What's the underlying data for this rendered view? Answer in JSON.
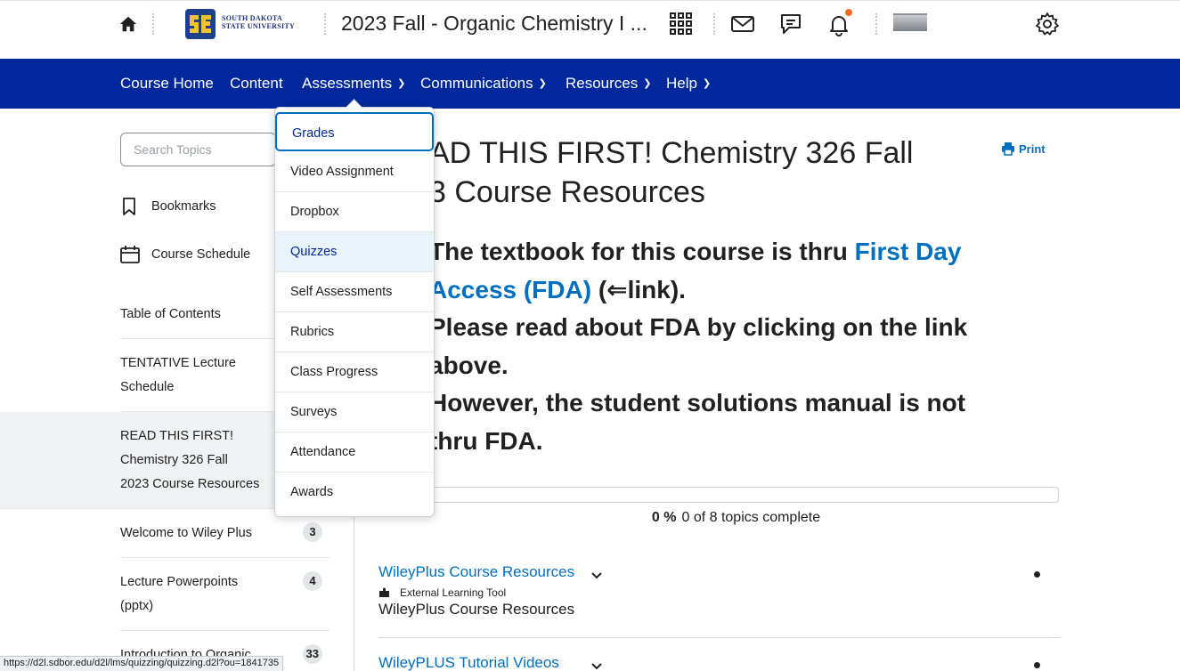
{
  "header": {
    "logo_line1": "South Dakota",
    "logo_line2": "State University",
    "course_title": "2023 Fall - Organic Chemistry I ..."
  },
  "nav": {
    "items": [
      {
        "label": "Course Home"
      },
      {
        "label": "Content"
      },
      {
        "label": "Assessments",
        "has_menu": true
      },
      {
        "label": "Communications",
        "has_menu": true
      },
      {
        "label": "Resources",
        "has_menu": true
      },
      {
        "label": "Help",
        "has_menu": true
      }
    ]
  },
  "dropdown": {
    "items": [
      {
        "label": "Grades",
        "state": "focused"
      },
      {
        "label": "Video Assignment"
      },
      {
        "label": "Dropbox"
      },
      {
        "label": "Quizzes",
        "state": "hover"
      },
      {
        "label": "Self Assessments"
      },
      {
        "label": "Rubrics"
      },
      {
        "label": "Class Progress"
      },
      {
        "label": "Surveys"
      },
      {
        "label": "Attendance"
      },
      {
        "label": "Awards"
      }
    ]
  },
  "sidebar": {
    "search_placeholder": "Search Topics",
    "bookmarks": "Bookmarks",
    "course_schedule": "Course Schedule",
    "toc": "Table of Contents",
    "items": [
      {
        "line1": "TENTATIVE Lecture",
        "line2": "Schedule"
      },
      {
        "line1": "READ THIS FIRST!",
        "line2": "Chemistry 326 Fall",
        "line3": "2023 Course Resources",
        "active": true
      },
      {
        "line1": "Welcome to Wiley Plus",
        "count": "3"
      },
      {
        "line1": "Lecture Powerpoints",
        "line2": "(pptx)",
        "count": "4"
      },
      {
        "line1": "Introduction to Organic",
        "count": "33"
      }
    ]
  },
  "main": {
    "title_line1": "AD THIS FIRST! Chemistry 326 Fall",
    "title_line2": "3 Course Resources",
    "print": "Print",
    "note": {
      "p1_before": "The textbook for this course is thru ",
      "p1_link_a": "First Day",
      "p1_link_b": "Access (FDA)",
      "p1_after": " (⇐link).",
      "p2a": "Please read about FDA by clicking on the link",
      "p2b": "above.",
      "p3a": "However, the student solutions manual is not",
      "p3b": "thru FDA."
    },
    "progress": {
      "percent_label": "0 %",
      "summary": "0 of 8 topics complete",
      "fraction": 0
    },
    "topics": [
      {
        "title": "WileyPlus Course Resources",
        "type": "External Learning Tool",
        "desc": "WileyPlus Course Resources"
      },
      {
        "title": "WileyPLUS Tutorial Videos"
      }
    ]
  },
  "status_url": "https://d2l.sdbor.edu/d2l/lms/quizzing/quizzing.d2l?ou=1841735",
  "colors": {
    "brand_blue": "#00289c",
    "link_blue": "#006fbf",
    "notification": "#f46a24"
  }
}
